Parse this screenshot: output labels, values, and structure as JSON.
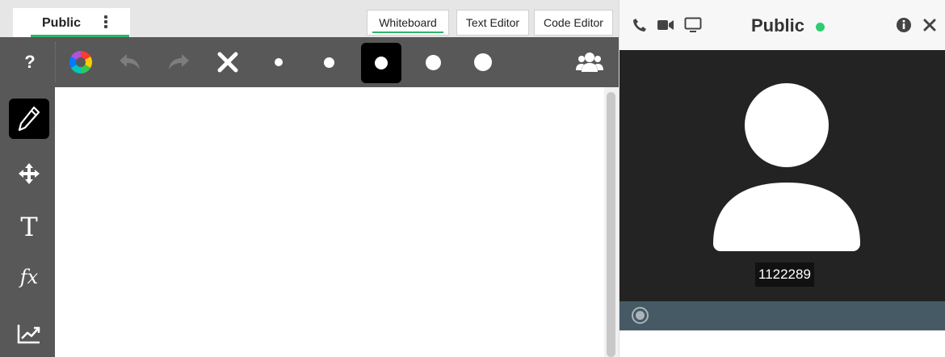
{
  "document_tab": {
    "label": "Public"
  },
  "mode_tabs": [
    {
      "label": "Whiteboard",
      "active": true
    },
    {
      "label": "Text Editor",
      "active": false
    },
    {
      "label": "Code Editor",
      "active": false
    }
  ],
  "toolbar": {
    "help_label": "?",
    "icons": [
      "color-wheel-icon",
      "undo-icon",
      "redo-icon",
      "clear-icon",
      "users-icon"
    ],
    "brush_sizes_count": 5,
    "active_brush_size_index": 2
  },
  "sidebar": {
    "tools": [
      {
        "name": "pencil",
        "active": true
      },
      {
        "name": "move",
        "active": false
      },
      {
        "name": "text",
        "glyph": "T",
        "active": false
      },
      {
        "name": "formula",
        "glyph": "fx",
        "active": false
      },
      {
        "name": "chart",
        "active": false
      }
    ]
  },
  "chat": {
    "room_title": "Public",
    "online": true,
    "user_id": "1122289",
    "header_icons": [
      "phone-icon",
      "video-camera-icon",
      "monitor-icon",
      "info-icon",
      "close-icon"
    ]
  },
  "colors": {
    "accent_green": "#2fb56b",
    "online_green": "#2ecc71",
    "toolbar_bg": "#585858",
    "video_bg": "#232323",
    "status_bar_bg": "#455a64"
  }
}
